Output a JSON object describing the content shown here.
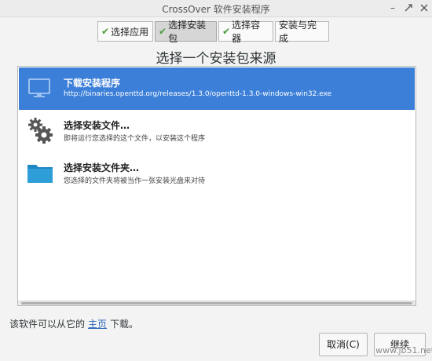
{
  "window": {
    "title": "CrossOver 软件安装程序",
    "min_glyph": "–",
    "max_icon": "maximize-icon",
    "close_icon": "close-icon"
  },
  "tabs": [
    {
      "label": "选择应用",
      "checked": true,
      "active": false
    },
    {
      "label": "选择安装包",
      "checked": true,
      "active": true
    },
    {
      "label": "选择容器",
      "checked": true,
      "active": false
    },
    {
      "label": "安装与完成",
      "checked": false,
      "active": false
    }
  ],
  "check_glyph": "✔",
  "heading": "选择一个安装包来源",
  "sources": [
    {
      "title": "下载安装程序",
      "subtitle": "http://binaries.openttd.org/releases/1.3.0/openttd-1.3.0-windows-win32.exe",
      "icon": "monitor-icon",
      "selected": true
    },
    {
      "title": "选择安装文件…",
      "subtitle": "即将运行您选择的这个文件，以安装这个程序",
      "icon": "gears-icon",
      "selected": false
    },
    {
      "title": "选择安装文件夹…",
      "subtitle": "您选择的文件夹将被当作一张安装光盘来对待",
      "icon": "folder-icon",
      "selected": false
    }
  ],
  "footer": {
    "prefix": "该软件可以从它的",
    "link": "主页",
    "suffix": "下载。"
  },
  "buttons": {
    "cancel": "取消(C)",
    "continue": "继续"
  },
  "watermark": "www.jb51.net",
  "colors": {
    "selection": "#3c7fd8",
    "check": "#4a9a3a",
    "link": "#2a67b8",
    "folder": "#2e9ed9"
  }
}
